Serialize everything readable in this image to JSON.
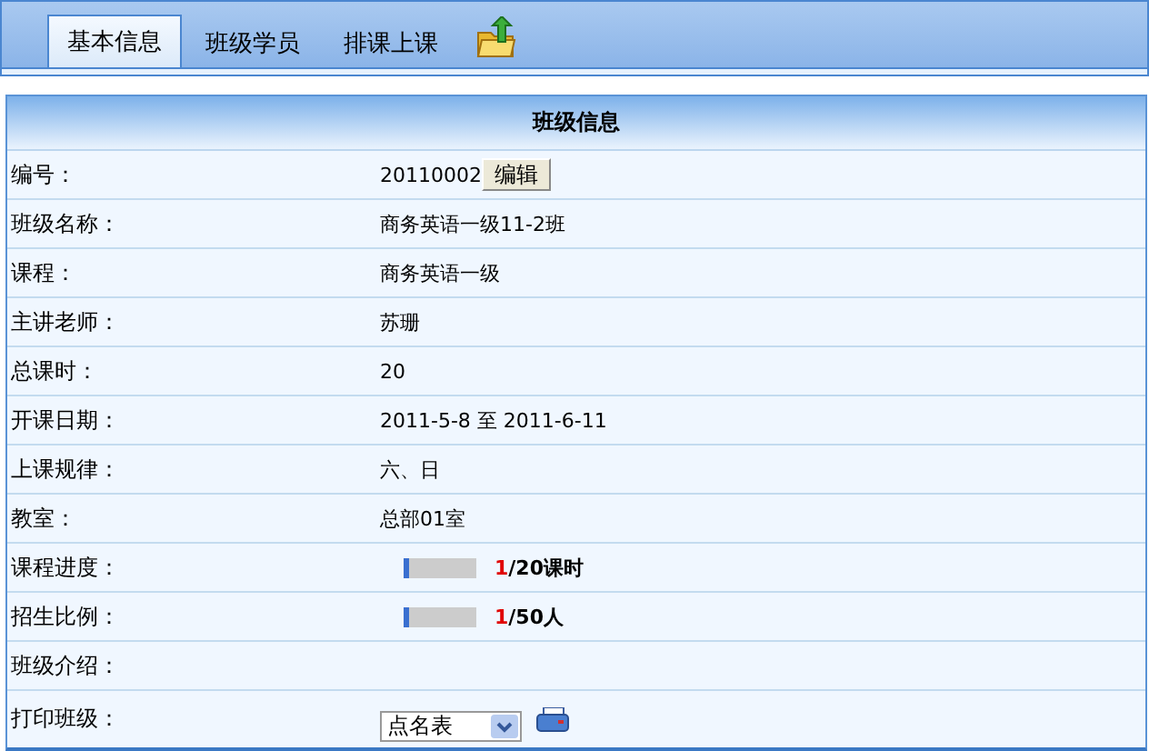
{
  "tabs": [
    {
      "label": "基本信息",
      "selected": true
    },
    {
      "label": "班级学员",
      "selected": false
    },
    {
      "label": "排课上课",
      "selected": false
    }
  ],
  "panel": {
    "title": "班级信息"
  },
  "rows": [
    {
      "kind": "edit",
      "label": "编号：",
      "value": "20110002",
      "button": "编辑"
    },
    {
      "kind": "text",
      "label": "班级名称：",
      "value": "商务英语一级11-2班"
    },
    {
      "kind": "text",
      "label": "课程：",
      "value": "商务英语一级"
    },
    {
      "kind": "text",
      "label": "主讲老师：",
      "value": "苏珊"
    },
    {
      "kind": "text",
      "label": "总课时：",
      "value": "20"
    },
    {
      "kind": "text",
      "label": "开课日期：",
      "value": "2011-5-8 至 2011-6-11"
    },
    {
      "kind": "text",
      "label": "上课规律：",
      "value": "六、日"
    },
    {
      "kind": "text",
      "label": "教室：",
      "value": "总部01室"
    },
    {
      "kind": "progress",
      "label": "课程进度：",
      "level": 0.05,
      "current": "1",
      "total": "/20课时"
    },
    {
      "kind": "progress",
      "label": "招生比例：",
      "level": 0.02,
      "current": "1",
      "total": "/50人"
    },
    {
      "kind": "text",
      "label": "班级介绍："
    },
    {
      "kind": "select",
      "label": "打印班级：",
      "value": "点名表"
    }
  ]
}
